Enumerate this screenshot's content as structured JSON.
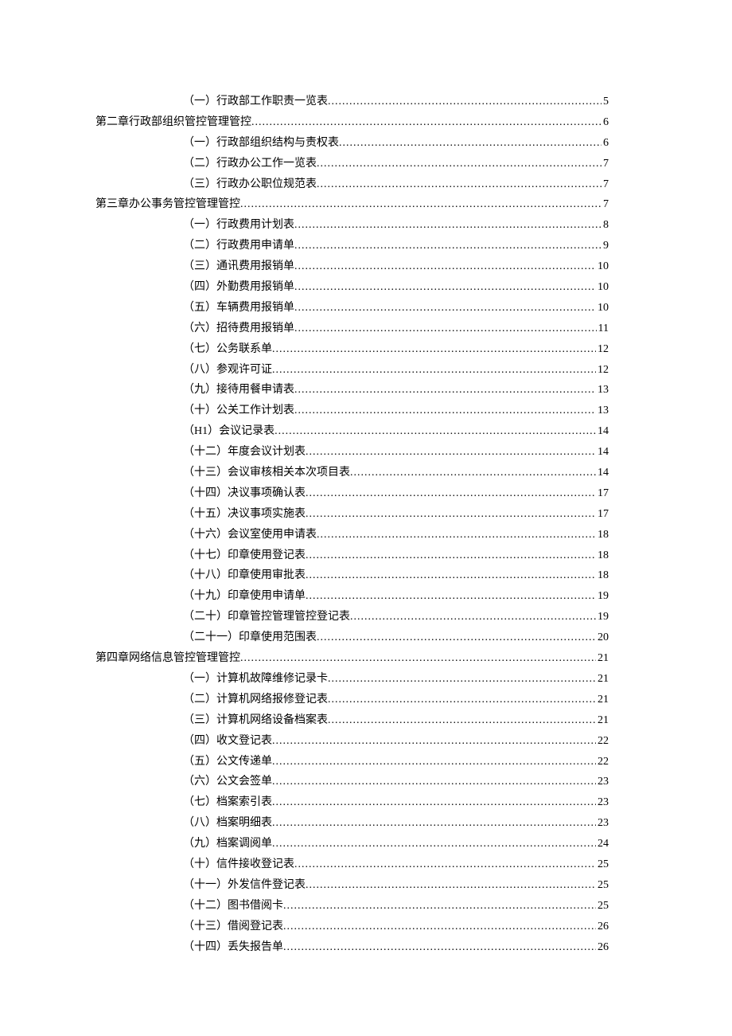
{
  "toc": [
    {
      "level": "item",
      "title": "（一）行政部工作职责一览表",
      "page": "5"
    },
    {
      "level": "chapter",
      "title": "第二章行政部组织管控管理管控",
      "page": "6"
    },
    {
      "level": "item",
      "title": "（一）行政部组织结构与责权表",
      "page": "6"
    },
    {
      "level": "item",
      "title": "（二）行政办公工作一览表",
      "page": "7"
    },
    {
      "level": "item",
      "title": "（三）行政办公职位规范表",
      "page": "7"
    },
    {
      "level": "chapter",
      "title": "第三章办公事务管控管理管控",
      "page": "7"
    },
    {
      "level": "item",
      "title": "（一）行政费用计划表",
      "page": "8"
    },
    {
      "level": "item",
      "title": "（二）行政费用申请单",
      "page": "9"
    },
    {
      "level": "item",
      "title": "（三）通讯费用报销单",
      "page": "10"
    },
    {
      "level": "item",
      "title": "（四）外勤费用报销单",
      "page": "10"
    },
    {
      "level": "item",
      "title": "（五）车辆费用报销单",
      "page": "10"
    },
    {
      "level": "item",
      "title": "（六）招待费用报销单",
      "page": "11"
    },
    {
      "level": "item",
      "title": "（七）公务联系单",
      "page": "12"
    },
    {
      "level": "item",
      "title": "（八）参观许可证",
      "page": "12"
    },
    {
      "level": "item",
      "title": "（九）接待用餐申请表",
      "page": "13"
    },
    {
      "level": "item",
      "title": "（十）公关工作计划表",
      "page": "13"
    },
    {
      "level": "item",
      "title": "（H1）会议记录表",
      "page": "14"
    },
    {
      "level": "item",
      "title": "（十二）年度会议计划表",
      "page": "14"
    },
    {
      "level": "item",
      "title": "（十三）会议审核相关本次项目表",
      "page": "14"
    },
    {
      "level": "item",
      "title": "（十四）决议事项确认表",
      "page": "17"
    },
    {
      "level": "item",
      "title": "（十五）决议事项实施表",
      "page": "17"
    },
    {
      "level": "item",
      "title": "（十六）会议室使用申请表",
      "page": "18"
    },
    {
      "level": "item",
      "title": "（十七）印章使用登记表",
      "page": "18"
    },
    {
      "level": "item",
      "title": "（十八）印章使用审批表",
      "page": "18"
    },
    {
      "level": "item",
      "title": "（十九）印章使用申请单",
      "page": "19"
    },
    {
      "level": "item",
      "title": "（二十）印章管控管理管控登记表",
      "page": "19"
    },
    {
      "level": "item",
      "title": "（二十一）印章使用范围表",
      "page": "20"
    },
    {
      "level": "chapter",
      "title": "第四章网络信息管控管理管控",
      "page": "21"
    },
    {
      "level": "item",
      "title": "（一）计算机故障维修记录卡",
      "page": "21"
    },
    {
      "level": "item",
      "title": "（二）计算机网络报修登记表",
      "page": "21"
    },
    {
      "level": "item",
      "title": "（三）计算机网络设备档案表",
      "page": "21"
    },
    {
      "level": "item",
      "title": "（四）收文登记表",
      "page": "22"
    },
    {
      "level": "item",
      "title": "（五）公文传递单",
      "page": "22"
    },
    {
      "level": "item",
      "title": "（六）公文会签单",
      "page": "23"
    },
    {
      "level": "item",
      "title": "（七）档案索引表",
      "page": "23"
    },
    {
      "level": "item",
      "title": "（八）档案明细表",
      "page": "23"
    },
    {
      "level": "item",
      "title": "（九）档案调阅单",
      "page": "24"
    },
    {
      "level": "item",
      "title": "（十）信件接收登记表",
      "page": "25"
    },
    {
      "level": "item",
      "title": "（十一）外发信件登记表",
      "page": "25"
    },
    {
      "level": "item",
      "title": "（十二）图书借阅卡",
      "page": "25"
    },
    {
      "level": "item",
      "title": "（十三）借阅登记表",
      "page": "26"
    },
    {
      "level": "item",
      "title": "（十四）丢失报告单",
      "page": "26"
    }
  ]
}
